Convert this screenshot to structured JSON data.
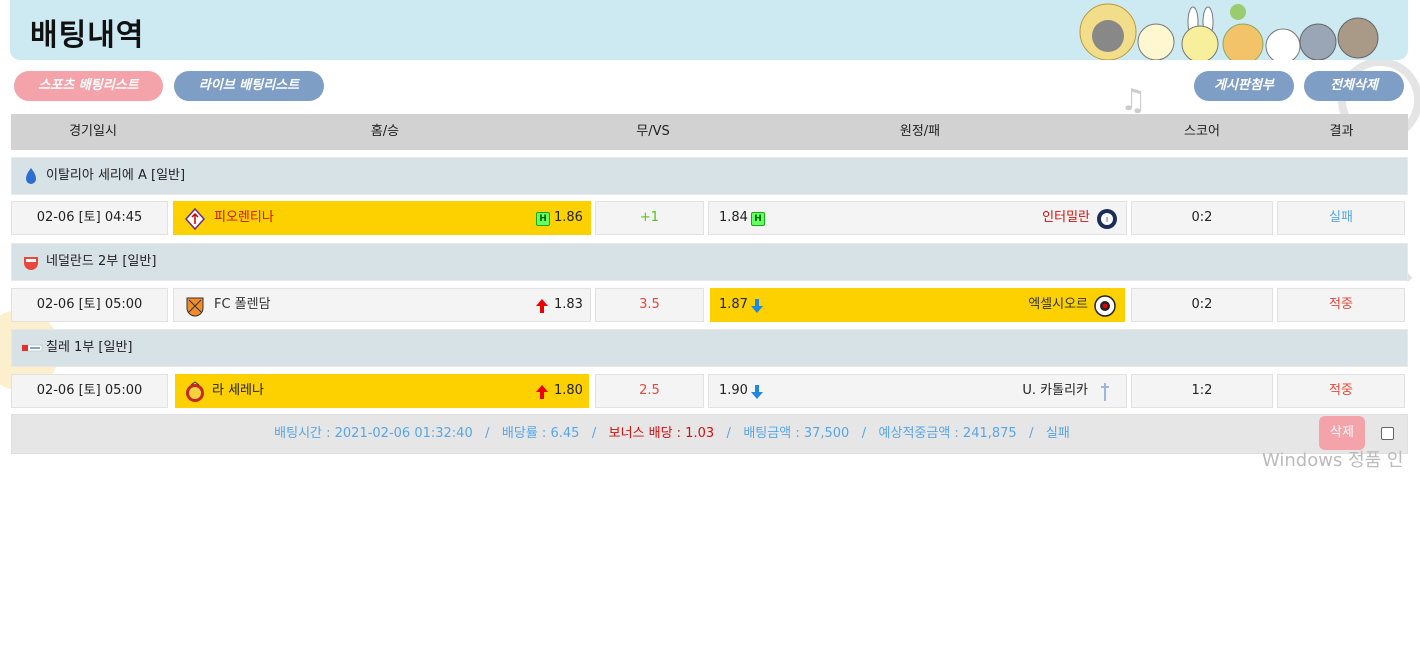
{
  "header": {
    "title": "배팅내역"
  },
  "tabs": {
    "sports": "스포츠 배팅리스트",
    "live": "라이브 배팅리스트"
  },
  "actions": {
    "board_attach": "게시판첨부",
    "delete_all": "전체삭제"
  },
  "columns": {
    "date": "경기일시",
    "home": "홈/승",
    "draw": "무/VS",
    "away": "원정/패",
    "score": "스코어",
    "result": "결과"
  },
  "leagues": [
    {
      "name": "이탈리아 세리에 A [일반]"
    },
    {
      "name": "네덜란드 2부 [일반]"
    },
    {
      "name": "칠레 1부 [일반]"
    }
  ],
  "rows": [
    {
      "date": "02-06 [토] 04:45",
      "home": "피오렌티나",
      "home_odds": "1.86",
      "home_badge": "H",
      "draw": "+1",
      "away_odds": "1.84",
      "away_badge": "H",
      "away": "인터밀란",
      "score": "0:2",
      "result": "실패"
    },
    {
      "date": "02-06 [토] 05:00",
      "home": "FC 폴렌담",
      "home_odds": "1.83",
      "draw": "3.5",
      "away_odds": "1.87",
      "away": "엑셀시오르",
      "score": "0:2",
      "result": "적중"
    },
    {
      "date": "02-06 [토] 05:00",
      "home": "라 세레나",
      "home_odds": "1.80",
      "draw": "2.5",
      "away_odds": "1.90",
      "away": "U. 카톨리카",
      "score": "1:2",
      "result": "적중"
    }
  ],
  "summary": {
    "bet_time": "배팅시간 : 2021-02-06 01:32:40",
    "odds": "배당률 : 6.45",
    "bonus": "보너스 배당 : 1.03",
    "amount": "배팅금액 : 37,500",
    "expected": "예상적중금액 : 241,875",
    "status": "실패",
    "sep": "/"
  },
  "delete_label": "삭제",
  "watermark": "Windows 정품 인",
  "colors": {
    "header_bg": "#cdeaf3",
    "selected": "#fdd000",
    "fail": "#58a6e6",
    "win": "#e8473b",
    "tab_active": "#f4a3ab",
    "tab_inactive": "#7e9ec6"
  },
  "icons": {
    "up": "arrow-up-icon",
    "down": "arrow-down-icon",
    "checkbox": "checkbox-icon"
  }
}
